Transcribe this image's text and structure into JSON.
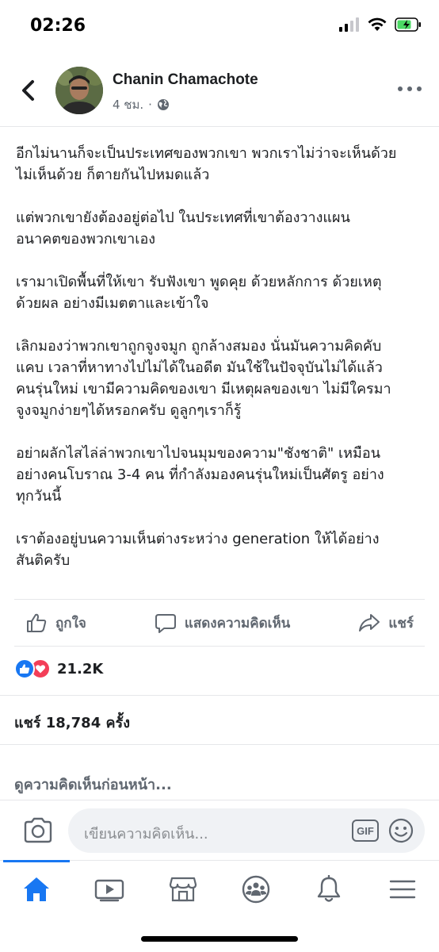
{
  "status": {
    "time": "02:26"
  },
  "header": {
    "author": "Chanin Chamachote",
    "meta_time": "4 ชม.",
    "meta_sep": "·",
    "icons": [
      "back-chevron-icon",
      "globe-icon",
      "more-dots-icon"
    ]
  },
  "post": {
    "paragraphs": [
      "อีกไม่นานก็จะเป็นประเทศของพวกเขา พวกเราไม่ว่าจะเห็นด้วย\nไม่เห็นด้วย ก็ตายกันไปหมดแล้ว",
      "แต่พวกเขายังต้องอยู่ต่อไป ในประเทศที่เขาต้องวางแผน\nอนาคตของพวกเขาเอง",
      "เรามาเปิดพื้นที่ให้เขา รับฟังเขา พูดคุย ด้วยหลักการ ด้วยเหตุ\nด้วยผล อย่างมีเมตตาและเข้าใจ",
      "เลิกมองว่าพวกเขาถูกจูงจมูก ถูกล้างสมอง นั่นมันความคิดคับ\nแคบ เวลาที่หาทางไปไม่ได้ในอดีต มันใช้ในปัจจุบันไม่ได้แล้ว\nคนรุ่นใหม่ เขามีความคิดของเขา มีเหตุผลของเขา ไม่มีใครมา\nจูงจมูกง่ายๆได้หรอกครับ ดูลูกๆเราก็รู้",
      "อย่าผลักไสไล่ล่าพวกเขาไปจนมุมของความ\"ชังชาติ\" เหมือน\nอย่างคนโบราณ 3-4 คน ที่กำลังมองคนรุ่นใหม่เป็นศัตรู อย่าง\nทุกวันนี้",
      "เราต้องอยู่บนความเห็นต่างระหว่าง generation ให้ได้อย่าง\nสันติครับ"
    ]
  },
  "actions": {
    "like": "ถูกใจ",
    "comment": "แสดงความคิดเห็น",
    "share": "แชร์"
  },
  "stats": {
    "reactions": "21.2K",
    "shares": "แชร์ 18,784 ครั้ง",
    "previous_comments": "ดูความคิดเห็นก่อนหน้า..."
  },
  "composer": {
    "placeholder": "เขียนความคิดเห็น...",
    "gif": "GIF"
  },
  "tabbar": {
    "tabs": [
      "home-icon",
      "watch-icon",
      "marketplace-icon",
      "groups-icon",
      "notifications-icon",
      "menu-icon"
    ],
    "active": "home-icon"
  },
  "colors": {
    "accent": "#1877f2",
    "love": "#f33e58",
    "secondary_text": "#606770",
    "battery": "#4cd964"
  }
}
